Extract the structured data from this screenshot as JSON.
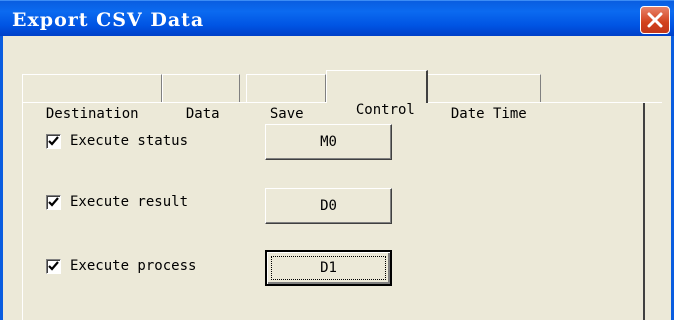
{
  "window": {
    "title": "Export CSV Data"
  },
  "tabs": [
    {
      "label": "Destination"
    },
    {
      "label": "Data"
    },
    {
      "label": "Save"
    },
    {
      "label": "Control",
      "active": true
    },
    {
      "label": "Date Time"
    }
  ],
  "control": {
    "rows": [
      {
        "label": "Execute status",
        "checked": true,
        "device": "M0"
      },
      {
        "label": "Execute result",
        "checked": true,
        "device": "D0"
      },
      {
        "label": "Execute process",
        "checked": true,
        "device": "D1",
        "focused": true
      }
    ]
  },
  "colors": {
    "titlebar": "#0054e3",
    "dialog_bg": "#ece9d8",
    "close_button": "#d2411c"
  }
}
